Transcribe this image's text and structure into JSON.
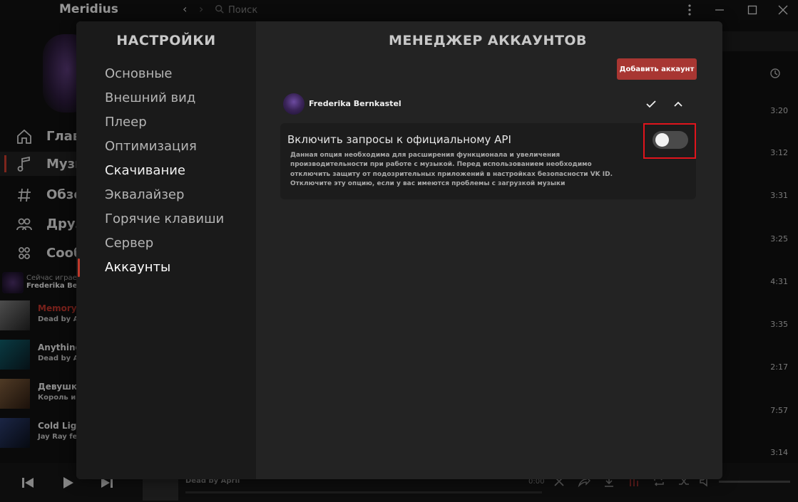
{
  "app": {
    "title": "Meridius",
    "search_placeholder": "Поиск"
  },
  "sidebar": {
    "items": [
      {
        "label": "Главная",
        "icon": "home-icon"
      },
      {
        "label": "Музыка",
        "icon": "music-note-icon"
      },
      {
        "label": "Обзор",
        "icon": "hashtag-icon"
      },
      {
        "label": "Друзья",
        "icon": "friends-icon"
      },
      {
        "label": "Сообщества",
        "icon": "communities-icon"
      }
    ]
  },
  "now_playing": {
    "label": "Сейчас играет",
    "artist": "Frederika Bernkastel"
  },
  "tracks": [
    {
      "title": "Memory",
      "artist": "Dead by April"
    },
    {
      "title": "Anything",
      "artist": "Dead by April"
    },
    {
      "title": "Девушка",
      "artist": "Король и Шут"
    },
    {
      "title": "Cold Light",
      "artist": "Jay Ray feat."
    }
  ],
  "durations": [
    "3:20",
    "3:12",
    "3:31",
    "3:25",
    "4:31",
    "3:35",
    "2:17",
    "7:57",
    "3:14"
  ],
  "player": {
    "artist": "Dead by April",
    "time": "0:00"
  },
  "settings": {
    "title": "НАСТРОЙКИ",
    "items": [
      "Основные",
      "Внешний вид",
      "Плеер",
      "Оптимизация",
      "Скачивание",
      "Эквалайзер",
      "Горячие клавиши",
      "Сервер",
      "Аккаунты"
    ],
    "selected_index": 8
  },
  "account_manager": {
    "title": "МЕНЕДЖЕР АККАУНТОВ",
    "add_button": "Добавить аккаунт",
    "account_name": "Frederika Bernkastel",
    "api_option": {
      "title": "Включить запросы к официальному API",
      "description": "Данная опция необходима для расширения функционала и увеличения производительности при работе с музыкой. Перед использованием необходимо отключить защиту от подозрительных приложений в настройках безопасности VK ID. Отключите эту опцию, если у вас имеются проблемы с загрузкой музыки",
      "enabled": false
    }
  },
  "colors": {
    "accent": "#a83632",
    "highlight": "#e0141c",
    "background": "#101010",
    "modal": "#232323"
  }
}
